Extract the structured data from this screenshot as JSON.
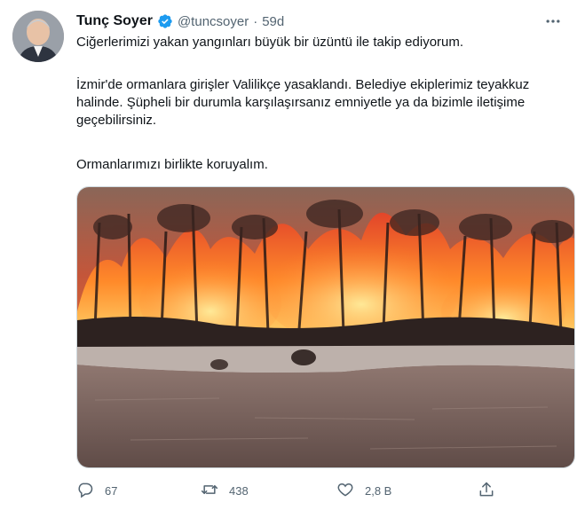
{
  "tweet": {
    "author_name": "Tunç Soyer",
    "handle": "@tuncsoyer",
    "separator": "·",
    "time": "59d",
    "paragraphs": [
      "Ciğerlerimizi yakan yangınları büyük bir üzüntü ile takip ediyorum.",
      "İzmir'de ormanlara girişler Valilikçe yasaklandı. Belediye ekiplerimiz teyakkuz halinde. Şüpheli bir durumla karşılaşırsanız emniyetle ya da bizimle iletişime geçebilirsiniz.",
      "Ormanlarımızı birlikte koruyalım."
    ],
    "media": {
      "icon": "forest-fire-photo"
    },
    "actions": {
      "replies": "67",
      "retweets": "438",
      "likes": "2,8 B"
    },
    "icons": {
      "more": "more-icon",
      "verified": "verified-badge-icon",
      "reply": "reply-icon",
      "retweet": "retweet-icon",
      "like": "heart-icon",
      "share": "share-icon"
    },
    "colors": {
      "text": "#0f1419",
      "muted": "#536471",
      "verified": "#1d9bf0"
    }
  }
}
